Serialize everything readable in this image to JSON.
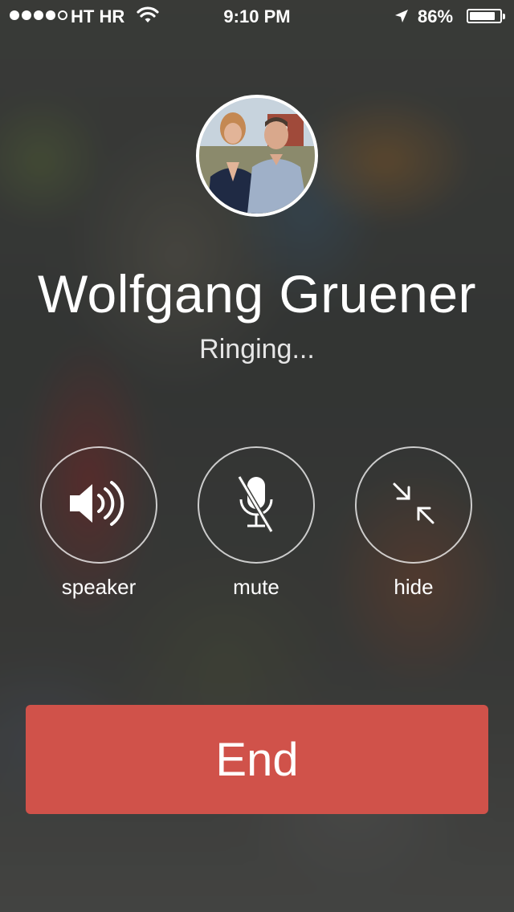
{
  "status_bar": {
    "carrier": "HT HR",
    "time": "9:10 PM",
    "battery_percent": "86%",
    "battery_level": 0.86,
    "signal_bars_filled": 4,
    "signal_bars_total": 5
  },
  "call": {
    "contact_name": "Wolfgang Gruener",
    "status": "Ringing..."
  },
  "controls": {
    "speaker_label": "speaker",
    "mute_label": "mute",
    "hide_label": "hide"
  },
  "end_button": {
    "label": "End",
    "color": "#d0524a"
  },
  "icons": {
    "signal": "signal-dots-icon",
    "wifi": "wifi-icon",
    "location": "location-arrow-icon",
    "battery": "battery-icon",
    "speaker": "speaker-icon",
    "mute": "microphone-off-icon",
    "hide": "collapse-arrows-icon"
  }
}
